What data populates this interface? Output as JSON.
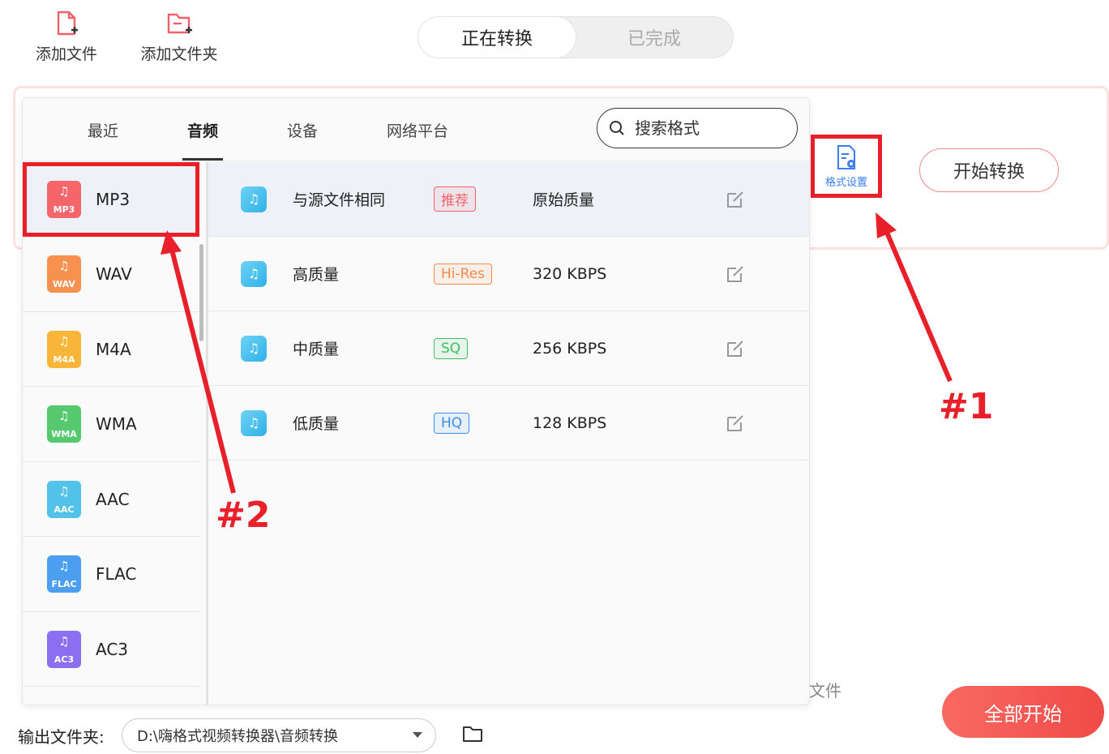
{
  "toolbar": {
    "add_file_label": "添加文件",
    "add_folder_label": "添加文件夹"
  },
  "status_tabs": {
    "converting": "正在转换",
    "completed": "已完成"
  },
  "format_popup": {
    "tabs": [
      "最近",
      "音频",
      "设备",
      "网络平台"
    ],
    "active_tab": "音频",
    "search_placeholder": "搜索格式",
    "formats": [
      {
        "name": "MP3",
        "tag": "MP3",
        "color": "#f5666b"
      },
      {
        "name": "WAV",
        "tag": "WAV",
        "color": "#f7914f"
      },
      {
        "name": "M4A",
        "tag": "M4A",
        "color": "#f8b53a"
      },
      {
        "name": "WMA",
        "tag": "WMA",
        "color": "#56c86e"
      },
      {
        "name": "AAC",
        "tag": "AAC",
        "color": "#52c2e8"
      },
      {
        "name": "FLAC",
        "tag": "FLAC",
        "color": "#4c9ff0"
      },
      {
        "name": "AC3",
        "tag": "AC3",
        "color": "#8a6ff0"
      }
    ],
    "selected_format": "MP3",
    "qualities": [
      {
        "name": "与源文件相同",
        "badge": "推荐",
        "badge_color": "#f0636a",
        "rate": "原始质量"
      },
      {
        "name": "高质量",
        "badge": "Hi-Res",
        "badge_color": "#f58a4a",
        "rate": "320 KBPS"
      },
      {
        "name": "中质量",
        "badge": "SQ",
        "badge_color": "#3cbf60",
        "rate": "256 KBPS"
      },
      {
        "name": "低质量",
        "badge": "HQ",
        "badge_color": "#3a8fe6",
        "rate": "128 KBPS"
      }
    ]
  },
  "task": {
    "format_settings_label": "格式设置",
    "start_convert_label": "开始转换"
  },
  "background_text": "文件",
  "start_all_label": "全部开始",
  "output": {
    "label": "输出文件夹:",
    "path": "D:\\嗨格式视频转换器\\音频转换"
  },
  "annotations": {
    "marker_1": "#1",
    "marker_2": "#2",
    "color": "#e8202a"
  }
}
